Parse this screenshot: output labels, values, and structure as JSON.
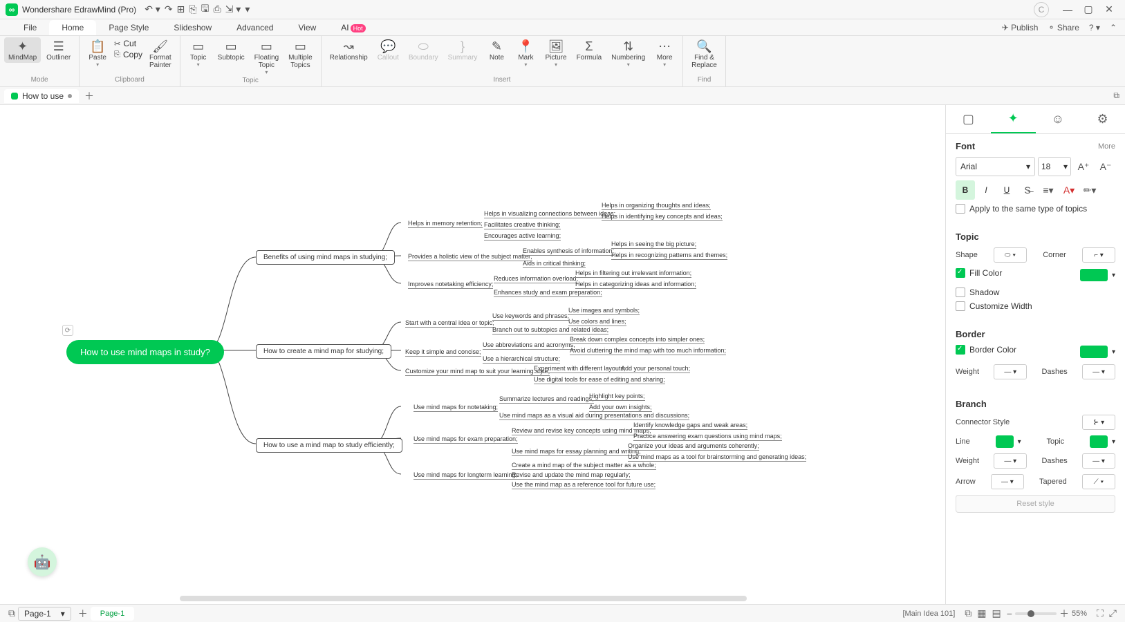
{
  "app_title": "Wondershare EdrawMind (Pro)",
  "user_initial": "C",
  "menus": [
    "File",
    "Home",
    "Page Style",
    "Slideshow",
    "Advanced",
    "View",
    "AI"
  ],
  "active_menu": "Home",
  "menu_right": {
    "publish": "Publish",
    "share": "Share"
  },
  "ribbon": {
    "mode": {
      "label": "Mode",
      "mindmap": "MindMap",
      "outliner": "Outliner"
    },
    "clipboard": {
      "label": "Clipboard",
      "paste": "Paste",
      "cut": "Cut",
      "copy": "Copy",
      "formatpainter": "Format\nPainter"
    },
    "topic": {
      "label": "Topic",
      "topic": "Topic",
      "subtopic": "Subtopic",
      "floating": "Floating\nTopic",
      "multiple": "Multiple\nTopics"
    },
    "insert": {
      "label": "Insert",
      "relationship": "Relationship",
      "callout": "Callout",
      "boundary": "Boundary",
      "summary": "Summary",
      "note": "Note",
      "mark": "Mark",
      "picture": "Picture",
      "formula": "Formula",
      "numbering": "Numbering",
      "more": "More"
    },
    "find": {
      "label": "Find",
      "findreplace": "Find &\nReplace"
    }
  },
  "doc_tab": "How to use",
  "side": {
    "font_title": "Font",
    "more": "More",
    "font_name": "Arial",
    "font_size": "18",
    "apply_same": "Apply to the same type of topics",
    "topic_title": "Topic",
    "shape": "Shape",
    "corner": "Corner",
    "fillcolor": "Fill Color",
    "shadow": "Shadow",
    "customwidth": "Customize Width",
    "border_title": "Border",
    "bordercolor": "Border Color",
    "weight": "Weight",
    "dashes": "Dashes",
    "branch_title": "Branch",
    "connstyle": "Connector Style",
    "line": "Line",
    "topic": "Topic",
    "arrow": "Arrow",
    "tapered": "Tapered",
    "reset": "Reset style"
  },
  "status": {
    "page1": "Page-1",
    "page1b": "Page-1",
    "context": "[Main Idea 101]",
    "zoom": "55%"
  },
  "mindmap": {
    "root": "How to use mind maps in study?",
    "b1": "Benefits of using mind maps in studying;",
    "b2": "How to create a mind map for studying;",
    "b3": "How to use a mind map to study efficiently;",
    "l1_1": "Helps in memory retention;",
    "l1_1_1": "Helps in visualizing connections between ideas;",
    "l1_1_2": "Facilitates creative thinking;",
    "l1_1_3": "Encourages active learning;",
    "l1_1_1_1": "Helps in organizing thoughts and ideas;",
    "l1_1_1_2": "Helps in identifying key concepts and ideas;",
    "l1_2": "Provides a holistic view of the subject matter;",
    "l1_2_1": "Enables synthesis of information;",
    "l1_2_2": "Aids in critical thinking;",
    "l1_2_1_1": "Helps in seeing the big picture;",
    "l1_2_1_2": "Helps in recognizing patterns and themes;",
    "l1_3": "Improves notetaking efficiency;",
    "l1_3_1": "Reduces information overload;",
    "l1_3_2": "Enhances study and exam preparation;",
    "l1_3_1_1": "Helps in filtering out irrelevant information;",
    "l1_3_1_2": "Helps in categorizing ideas and information;",
    "l2_1": "Start with a central idea or topic;",
    "l2_1_1": "Use keywords and phrases;",
    "l2_1_2": "Branch out to subtopics and related ideas;",
    "l2_1_1_1": "Use images and symbols;",
    "l2_1_1_2": "Use colors and lines;",
    "l2_2": "Keep it simple and concise;",
    "l2_2_1": "Use abbreviations and acronyms;",
    "l2_2_2": "Use a hierarchical structure;",
    "l2_2_1_1": "Break down complex concepts into simpler ones;",
    "l2_2_1_2": "Avoid cluttering the mind map with too much information;",
    "l2_3": "Customize your mind map to suit your learning style;",
    "l2_3_1": "Experiment with different layouts;",
    "l2_3_2": "Use digital tools for ease of editing and sharing;",
    "l2_3_1_1": "Add your personal touch;",
    "l3_1": "Use mind maps for notetaking;",
    "l3_1_1": "Summarize lectures and readings;",
    "l3_1_2": "Use mind maps as a visual aid during presentations and discussions;",
    "l3_1_1_1": "Highlight key points;",
    "l3_1_1_2": "Add your own insights;",
    "l3_2": "Use mind maps for exam preparation;",
    "l3_2_1": "Review and revise key concepts using mind maps;",
    "l3_2_2": "Use mind maps for essay planning and writing;",
    "l3_2_1_1": "Identify knowledge gaps and weak areas;",
    "l3_2_1_2": "Practice answering exam questions using mind maps;",
    "l3_2_2_1": "Organize your ideas and arguments coherently;",
    "l3_2_2_2": "Use mind maps as a tool for brainstorming and generating ideas;",
    "l3_3": "Use mind maps for longterm learning;",
    "l3_3_1": "Create a mind map of the subject matter as a whole;",
    "l3_3_2": "Revise and update the mind map regularly;",
    "l3_3_3": "Use the mind map as a reference tool for future use;"
  }
}
